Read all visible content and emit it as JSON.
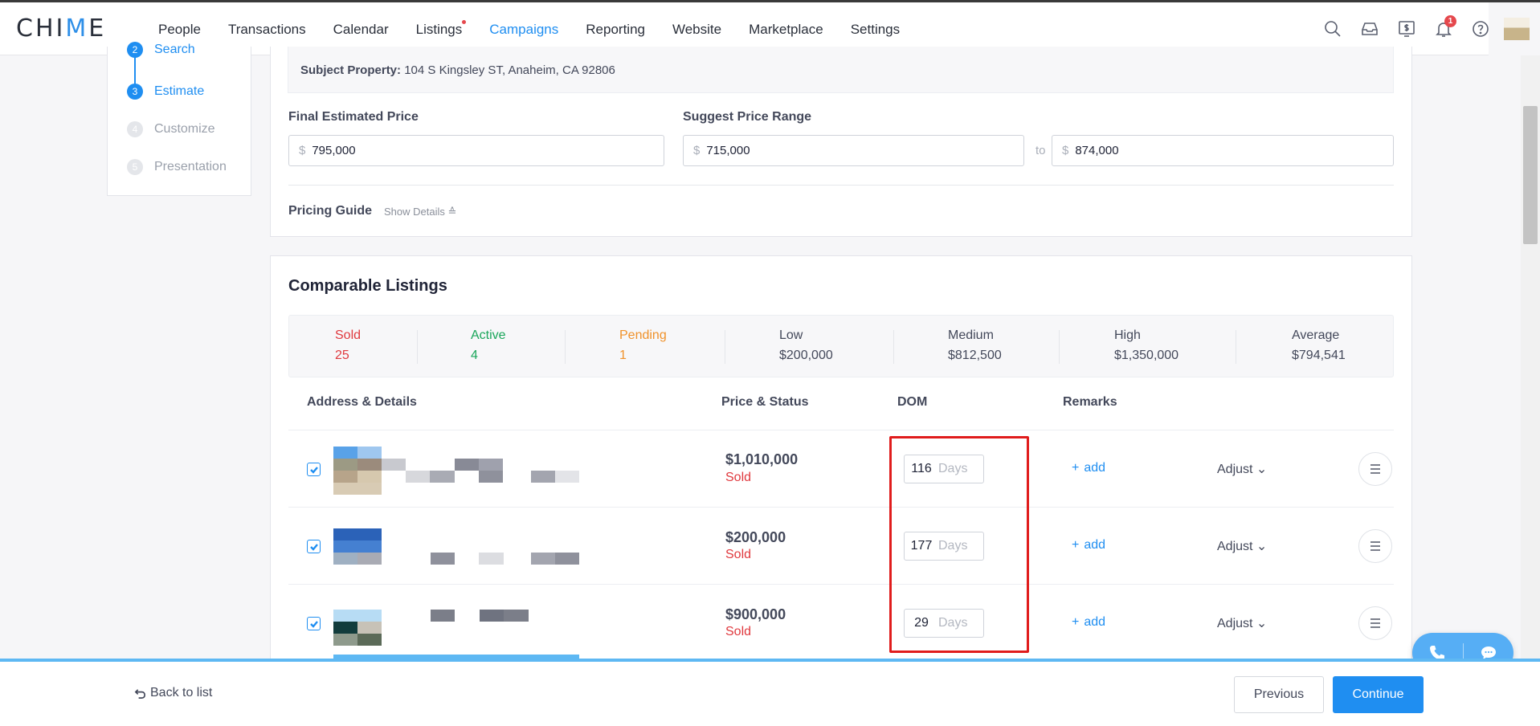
{
  "app": {
    "logo_left": "CHI",
    "logo_accent": "M",
    "logo_right": "E"
  },
  "nav": {
    "items": [
      {
        "label": "People"
      },
      {
        "label": "Transactions"
      },
      {
        "label": "Calendar"
      },
      {
        "label": "Listings"
      },
      {
        "label": "Campaigns"
      },
      {
        "label": "Reporting"
      },
      {
        "label": "Website"
      },
      {
        "label": "Marketplace"
      },
      {
        "label": "Settings"
      }
    ],
    "active": "Campaigns",
    "notification_count": "1"
  },
  "steps": {
    "items": [
      {
        "num": "2",
        "label": "Search",
        "state": "done"
      },
      {
        "num": "3",
        "label": "Estimate",
        "state": "active"
      },
      {
        "num": "4",
        "label": "Customize",
        "state": "pending"
      },
      {
        "num": "5",
        "label": "Presentation",
        "state": "pending"
      }
    ]
  },
  "estimate": {
    "subject_label": "Subject Property:",
    "subject_value": "104 S Kingsley ST, Anaheim, CA 92806",
    "final_label": "Final Estimated Price",
    "final_value": "795,000",
    "range_label": "Suggest Price Range",
    "range_low": "715,000",
    "range_to": "to",
    "range_high": "874,000",
    "currency": "$",
    "pricing_guide": "Pricing Guide",
    "show_details": "Show Details"
  },
  "comparables": {
    "title": "Comparable Listings",
    "stats": [
      {
        "label": "Sold",
        "value": "25",
        "color": "#e0393e"
      },
      {
        "label": "Active",
        "value": "4",
        "color": "#1aa65a"
      },
      {
        "label": "Pending",
        "value": "1",
        "color": "#f0922b"
      },
      {
        "label": "Low",
        "value": "$200,000",
        "color": "#43485a"
      },
      {
        "label": "Medium",
        "value": "$812,500",
        "color": "#43485a"
      },
      {
        "label": "High",
        "value": "$1,350,000",
        "color": "#43485a"
      },
      {
        "label": "Average",
        "value": "$794,541",
        "color": "#43485a"
      }
    ],
    "columns": {
      "address": "Address & Details",
      "price": "Price & Status",
      "dom": "DOM",
      "remarks": "Remarks"
    },
    "rows": [
      {
        "price": "$1,010,000",
        "status": "Sold",
        "dom": "116",
        "dom_unit": "Days",
        "add": "add",
        "adjust": "Adjust"
      },
      {
        "price": "$200,000",
        "status": "Sold",
        "dom": "177",
        "dom_unit": "Days",
        "add": "add",
        "adjust": "Adjust"
      },
      {
        "price": "$900,000",
        "status": "Sold",
        "dom": "29",
        "dom_unit": "Days",
        "add": "add",
        "adjust": "Adjust"
      }
    ]
  },
  "footer": {
    "back": "Back to list",
    "previous": "Previous",
    "continue": "Continue"
  },
  "colors": {
    "accent": "#1f8ef1",
    "highlight": "#e01c1c"
  }
}
